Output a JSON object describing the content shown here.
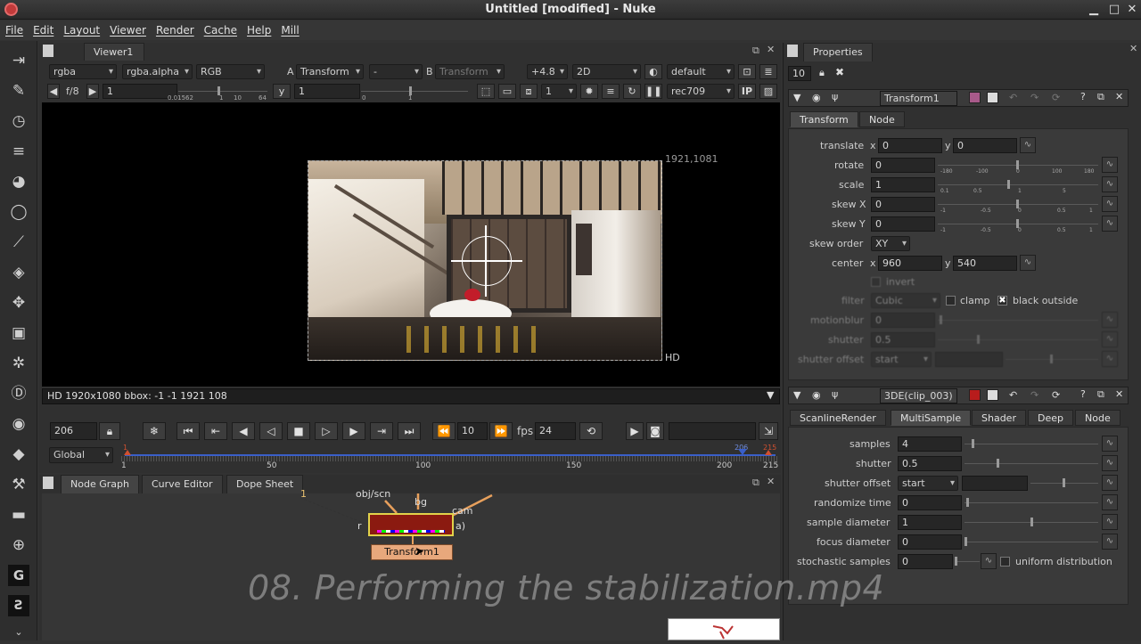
{
  "window": {
    "title": "Untitled [modified] - Nuke"
  },
  "menu": [
    "File",
    "Edit",
    "Layout",
    "Viewer",
    "Render",
    "Cache",
    "Help",
    "Mill"
  ],
  "viewer": {
    "tab": "Viewer1",
    "channels": "rgba",
    "alpha": "rgba.alpha",
    "display": "RGB",
    "input_a_label": "A",
    "input_a": "Transform",
    "input_a_op": "-",
    "input_b_label": "B",
    "input_b": "Transform",
    "gain": "+4.8",
    "view_mode": "2D",
    "lut": "default",
    "fstop": "f/8",
    "gain_value": "1",
    "gamma_label": "y",
    "gamma_value": "1",
    "proxy": "1",
    "colorspace": "rec709",
    "ip_label": "IP",
    "slider_ticks_left": "0.01562",
    "slider_tick_r": "1",
    "slider_tick_10": "10",
    "slider_tick_64": "64",
    "slider_tick_0": "0",
    "format_top_right": "1921,1081",
    "format_bottom_right": "HD",
    "status_line": "HD 1920x1080 bbox: -1 -1 1921 108"
  },
  "playback": {
    "current_frame": "206",
    "increment": "10",
    "fps_label": "fps",
    "fps": "24",
    "range_mode": "Global",
    "ticks": [
      "1",
      "50",
      "100",
      "150",
      "200",
      "215"
    ],
    "marker_start": "1",
    "marker_current": "206",
    "marker_end": "215"
  },
  "nodegraph": {
    "tabs": [
      "Node Graph",
      "Curve Editor",
      "Dope Sheet"
    ],
    "node_label": "Transform1",
    "labels": {
      "obj": "obj/scn",
      "bg": "bg",
      "cam": "cam",
      "n": "1",
      "r": "r",
      "a": "a)"
    }
  },
  "properties": {
    "tab": "Properties",
    "max_panels": "10",
    "transform_node": {
      "name": "Transform1",
      "tabs": [
        "Transform",
        "Node"
      ],
      "translate_label": "translate",
      "translate_x": "0",
      "translate_y": "0",
      "rotate_label": "rotate",
      "rotate": "0",
      "scale_label": "scale",
      "scale": "1",
      "skewx_label": "skew X",
      "skewx": "0",
      "skewy_label": "skew Y",
      "skewy": "0",
      "skew_order_label": "skew order",
      "skew_order": "XY",
      "center_label": "center",
      "center_x": "960",
      "center_y": "540",
      "invert_label": "invert",
      "filter_label": "filter",
      "filter": "Cubic",
      "clamp_label": "clamp",
      "black_outside_label": "black outside",
      "motionblur_label": "motionblur",
      "motionblur": "0",
      "shutter_label": "shutter",
      "shutter": "0.5",
      "shutter_offset_label": "shutter offset",
      "shutter_offset": "start",
      "x_label": "x",
      "y_label": "y",
      "rotate_ticks": [
        "-180",
        "-100",
        "0",
        "100",
        "180"
      ],
      "scale_ticks": [
        "0.1",
        "0.5",
        "1",
        "5"
      ],
      "skew_ticks": [
        "-1",
        "-0.5",
        "0",
        "0.5",
        "1"
      ]
    },
    "scanline_node": {
      "name": "3DE(clip_003)",
      "tabs": [
        "ScanlineRender",
        "MultiSample",
        "Shader",
        "Deep",
        "Node"
      ],
      "samples_label": "samples",
      "samples": "4",
      "shutter_label": "shutter",
      "shutter": "0.5",
      "shutter_offset_label": "shutter offset",
      "shutter_offset": "start",
      "randomize_label": "randomize time",
      "randomize": "0",
      "sample_diameter_label": "sample diameter",
      "sample_diameter": "1",
      "focus_diameter_label": "focus diameter",
      "focus_diameter": "0",
      "stochastic_label": "stochastic samples",
      "stochastic": "0",
      "uniform_label": "uniform distribution"
    }
  },
  "watermark": "08. Performing the stabilization.mp4",
  "colors": {
    "accent": "#c23a3a",
    "node_red": "#8b1a10",
    "node_transform": "#e8a87c",
    "timeline_blue": "#3a5fc9"
  }
}
